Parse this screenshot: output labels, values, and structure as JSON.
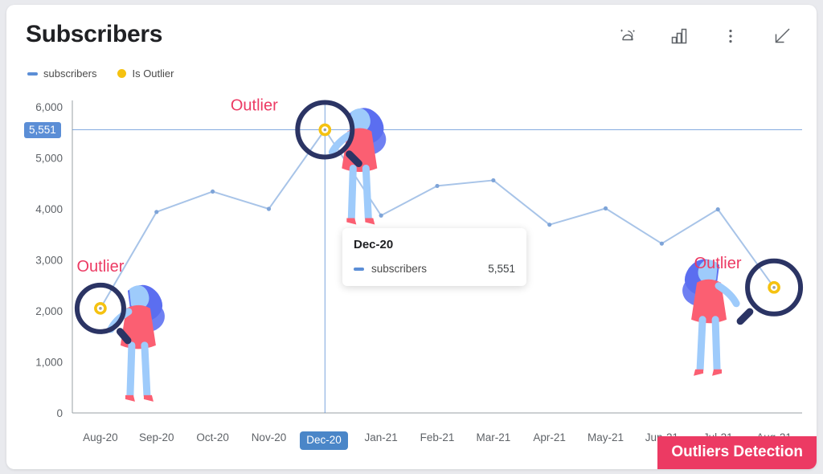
{
  "header": {
    "title": "Subscribers",
    "toolbar": [
      {
        "name": "ai-insights-icon",
        "label": "AI Insights"
      },
      {
        "name": "bar-chart-icon",
        "label": "Change visualization"
      },
      {
        "name": "more-vertical-icon",
        "label": "More options"
      },
      {
        "name": "collapse-arrow-icon",
        "label": "Collapse"
      }
    ]
  },
  "legend": [
    {
      "label": "subscribers",
      "marker": "dash",
      "color": "#5b8ed6"
    },
    {
      "label": "Is Outlier",
      "marker": "dot",
      "color": "#f5c211"
    }
  ],
  "highlight": {
    "y_value_pill": "5,551",
    "x_value_pill": "Dec-20"
  },
  "tooltip": {
    "title": "Dec-20",
    "series_label": "subscribers",
    "value": "5,551"
  },
  "annotations": [
    {
      "label": "Outlier",
      "month": "Aug-20"
    },
    {
      "label": "Outlier",
      "month": "Dec-20"
    },
    {
      "label": "Outlier",
      "month": "Aug-21"
    }
  ],
  "banner": {
    "label": "Outliers Detection",
    "color": "#ec3a63"
  },
  "colors": {
    "line": "#a8c4e8",
    "accent": "#5b8ed6",
    "outlier": "#f5c211",
    "magnifier": "#2b3464",
    "pink": "#ec3a63"
  },
  "chart_data": {
    "type": "line",
    "title": "Subscribers",
    "xlabel": "",
    "ylabel": "",
    "ylim": [
      0,
      6000
    ],
    "yticks": [
      "0",
      "1,000",
      "2,000",
      "3,000",
      "4,000",
      "5,000",
      "6,000"
    ],
    "grid": false,
    "legend_position": "top-left",
    "categories": [
      "Aug-20",
      "Sep-20",
      "Oct-20",
      "Nov-20",
      "Dec-20",
      "Jan-21",
      "Feb-21",
      "Mar-21",
      "Apr-21",
      "May-21",
      "Jun-21",
      "Jul-21",
      "Aug-21"
    ],
    "series": [
      {
        "name": "subscribers",
        "values": [
          2050,
          3940,
          4340,
          4000,
          5551,
          3870,
          4450,
          4560,
          3690,
          4010,
          3320,
          3990,
          2460
        ]
      }
    ],
    "outliers": [
      {
        "category": "Aug-20",
        "value": 2050
      },
      {
        "category": "Dec-20",
        "value": 5551
      },
      {
        "category": "Aug-21",
        "value": 2460
      }
    ],
    "reference_line": {
      "value": 5551,
      "label": "5,551"
    },
    "selected_category": "Dec-20"
  }
}
